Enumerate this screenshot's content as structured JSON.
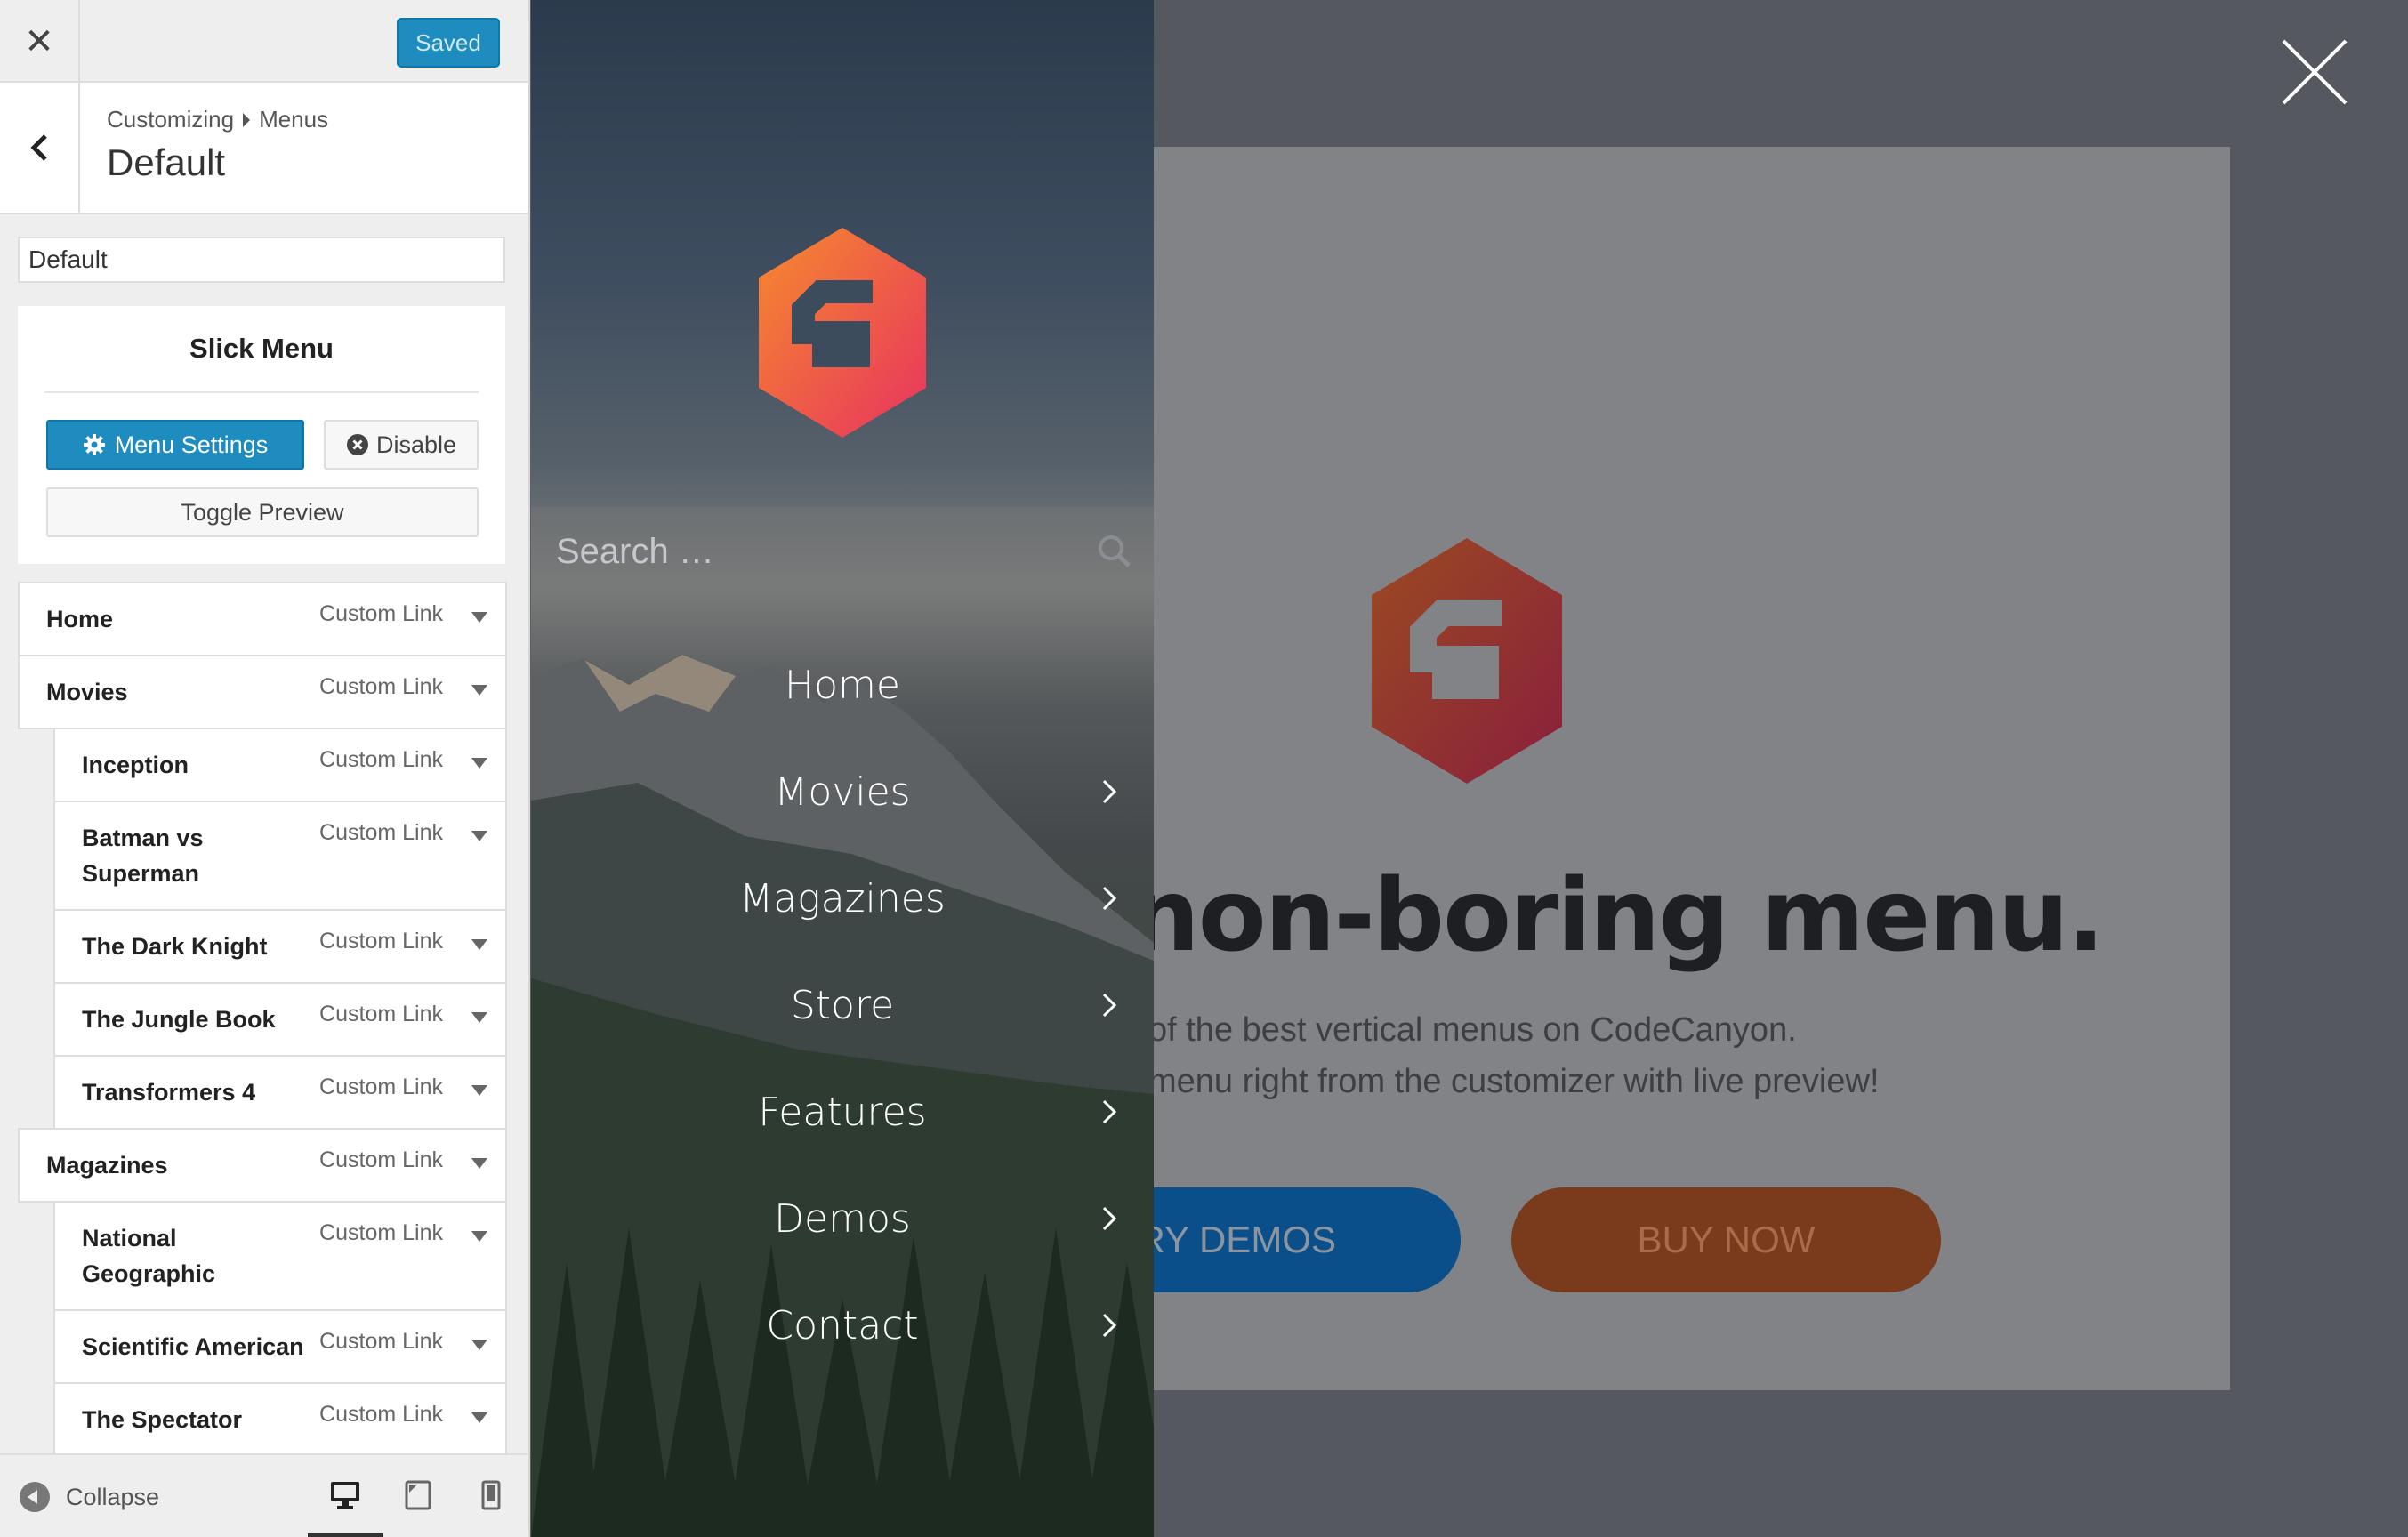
{
  "topbar": {
    "saved_label": "Saved"
  },
  "header": {
    "breadcrumb_root": "Customizing",
    "breadcrumb_section": "Menus",
    "title": "Default"
  },
  "menu_name_value": "Default",
  "slick": {
    "title": "Slick Menu",
    "settings_label": "Menu Settings",
    "disable_label": "Disable",
    "toggle_preview_label": "Toggle Preview"
  },
  "menu_items": [
    {
      "label": "Home",
      "type": "Custom Link"
    },
    {
      "label": "Movies",
      "type": "Custom Link"
    },
    {
      "label": "Inception",
      "type": "Custom Link"
    },
    {
      "label": "Batman vs Superman",
      "type": "Custom Link"
    },
    {
      "label": "The Dark Knight",
      "type": "Custom Link"
    },
    {
      "label": "The Jungle Book",
      "type": "Custom Link"
    },
    {
      "label": "Transformers 4",
      "type": "Custom Link"
    },
    {
      "label": "Magazines",
      "type": "Custom Link"
    },
    {
      "label": "National Geographic",
      "type": "Custom Link"
    },
    {
      "label": "Scientific American",
      "type": "Custom Link"
    },
    {
      "label": "The Spectator",
      "type": "Custom Link"
    }
  ],
  "footer": {
    "collapse_label": "Collapse"
  },
  "slickmenu": {
    "search_placeholder": "Search …",
    "nav": [
      "Home",
      "Movies",
      "Magazines",
      "Store",
      "Features",
      "Demos",
      "Contact"
    ]
  },
  "preview": {
    "hero_title": "non-boring menu.",
    "hero_sub1": "of the best vertical menus on CodeCanyon.",
    "hero_sub2": "menu right from the customizer with live preview!",
    "demos_label": "RY DEMOS",
    "buy_label": "BUY NOW"
  },
  "colors": {
    "accent": "#1e8cbe",
    "logo_orange": "#f26b3a",
    "logo_pink": "#e8335f"
  }
}
